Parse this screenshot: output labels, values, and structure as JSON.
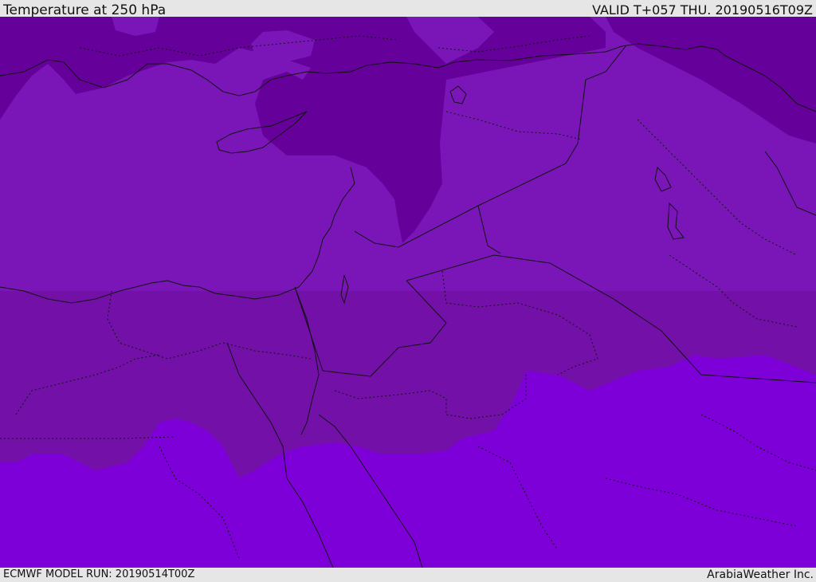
{
  "header": {
    "title": "Temperature at 250 hPa",
    "valid": "VALID T+057 THU. 20190516T09Z"
  },
  "footer": {
    "model_run": "ECMWF MODEL RUN: 20190514T00Z",
    "credit": "ArabiaWeather Inc."
  },
  "map": {
    "colors": {
      "coldest_band": "#66009a",
      "cold_band": "#7a16b8",
      "mid_band": "#7210a8",
      "warm_band": "#7e00d8",
      "coastline": "#111111",
      "borders": "#111111"
    }
  }
}
